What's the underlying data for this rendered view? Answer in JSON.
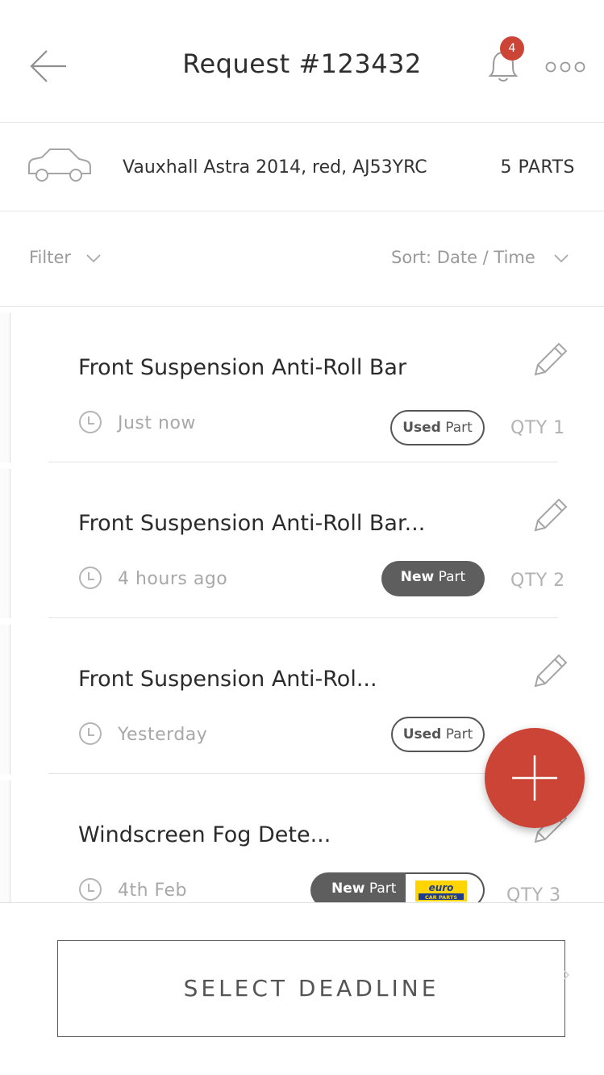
{
  "header": {
    "title": "Request #123432",
    "notification_count": "4"
  },
  "vehicle": {
    "description": "Vauxhall Astra 2014, red, AJ53YRC",
    "parts_count": "5 PARTS"
  },
  "toolbar": {
    "filter_label": "Filter",
    "sort_label": "Sort: Date / Time"
  },
  "parts": [
    {
      "name": "Front Suspension Anti-Roll Bar",
      "time": "Just now",
      "condition_bold": "Used",
      "condition_light": "Part",
      "condition_type": "used",
      "qty": "QTY 1"
    },
    {
      "name": "Front Suspension Anti-Roll Bar...",
      "time": "4 hours ago",
      "condition_bold": "New",
      "condition_light": "Part",
      "condition_type": "new",
      "qty": "QTY 2"
    },
    {
      "name": "Front Suspension Anti-Rol...",
      "time": "Yesterday",
      "condition_bold": "Used",
      "condition_light": "Part",
      "condition_type": "used",
      "qty": ""
    },
    {
      "name": "Windscreen Fog Dete...",
      "time": "4th Feb",
      "condition_bold": "New",
      "condition_light": "Part",
      "condition_type": "new",
      "qty": "QTY 3",
      "supplier_logo": "euro-car-parts-logo"
    }
  ],
  "footer": {
    "deadline_label": "SELECT DEADLINE"
  },
  "colors": {
    "accent": "#cc4436",
    "dark_pill": "#5e5e5e"
  }
}
